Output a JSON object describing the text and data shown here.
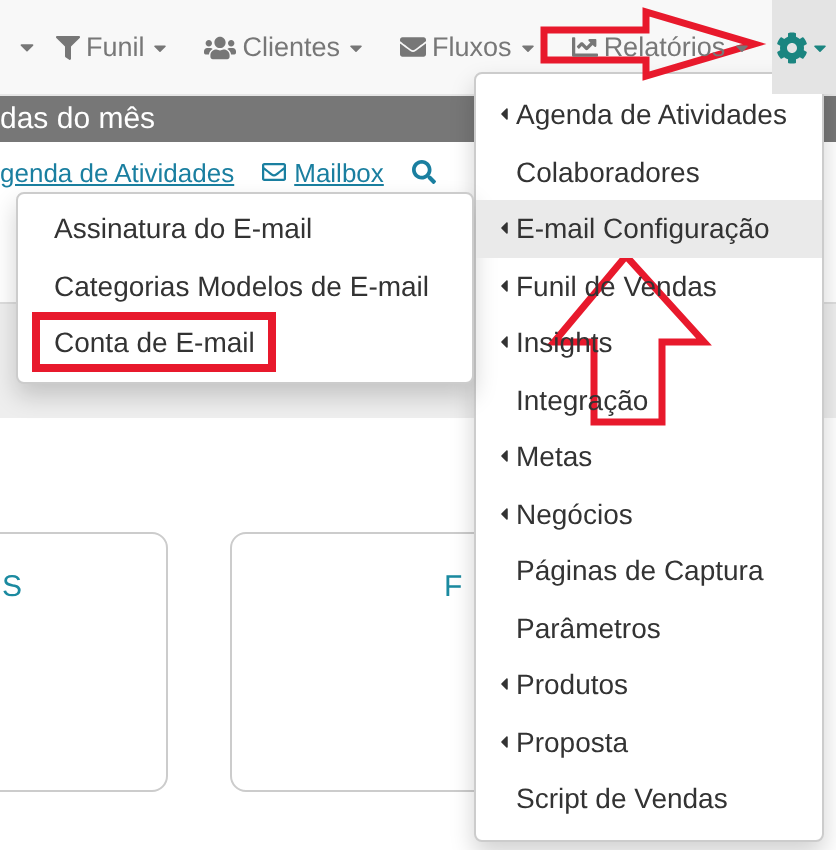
{
  "navbar": {
    "items": [
      {
        "label": "Funil"
      },
      {
        "label": "Clientes"
      },
      {
        "label": "Fluxos"
      },
      {
        "label": "Relatórios"
      }
    ],
    "settings": {
      "selected": true
    }
  },
  "banner": {
    "title": "das do mês"
  },
  "links": [
    {
      "label": "genda de Atividades"
    },
    {
      "label": "Mailbox"
    }
  ],
  "cards": [
    {
      "title": "S"
    },
    {
      "title": "F"
    }
  ],
  "settings_menu": {
    "items": [
      {
        "label": "Agenda de Atividades",
        "kind": "submenu",
        "selected": false
      },
      {
        "label": "Colaboradores",
        "kind": "item",
        "selected": false
      },
      {
        "label": "E-mail Configuração",
        "kind": "submenu",
        "selected": true
      },
      {
        "label": "Funil de Vendas",
        "kind": "submenu",
        "selected": false
      },
      {
        "label": "Insights",
        "kind": "submenu",
        "selected": false
      },
      {
        "label": "Integração",
        "kind": "item",
        "selected": false
      },
      {
        "label": "Metas",
        "kind": "submenu",
        "selected": false
      },
      {
        "label": "Negócios",
        "kind": "submenu",
        "selected": false
      },
      {
        "label": "Páginas de Captura",
        "kind": "item",
        "selected": false
      },
      {
        "label": "Parâmetros",
        "kind": "item",
        "selected": false
      },
      {
        "label": "Produtos",
        "kind": "submenu",
        "selected": false
      },
      {
        "label": "Proposta",
        "kind": "submenu",
        "selected": false
      },
      {
        "label": "Script de Vendas",
        "kind": "item",
        "selected": false
      }
    ]
  },
  "email_submenu": {
    "items": [
      {
        "label": "Assinatura do E-mail",
        "highlighted": false
      },
      {
        "label": "Categorias Modelos de E-mail",
        "highlighted": false
      },
      {
        "label": "Conta de E-mail",
        "highlighted": true
      }
    ]
  }
}
